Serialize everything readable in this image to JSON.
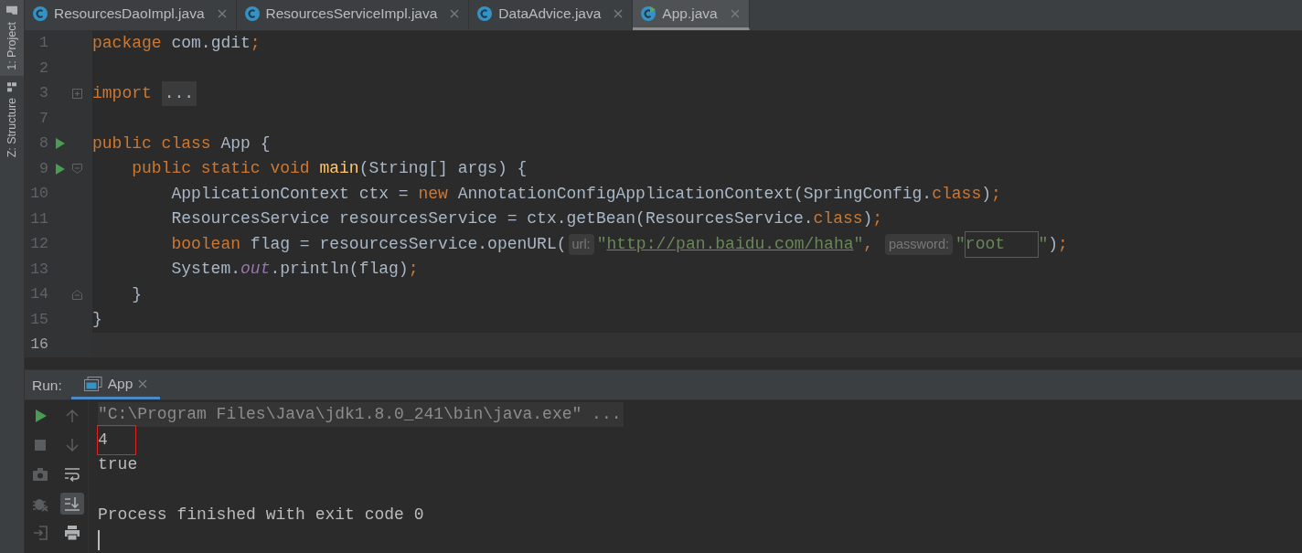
{
  "sidebar": {
    "items": [
      {
        "label": "1: Project",
        "kind": "folder"
      },
      {
        "label": "Z: Structure",
        "kind": "structure"
      }
    ]
  },
  "tabs": [
    {
      "label": "ResourcesDaoImpl.java",
      "kind": "class",
      "selected": false
    },
    {
      "label": "ResourcesServiceImpl.java",
      "kind": "class",
      "selected": false
    },
    {
      "label": "DataAdvice.java",
      "kind": "class",
      "selected": false
    },
    {
      "label": "App.java",
      "kind": "runnable-class",
      "selected": true
    }
  ],
  "editor": {
    "lines": [
      {
        "number": "1",
        "kind": "code",
        "current": false,
        "run": false,
        "tokens": [
          {
            "kind": "kw",
            "text": "package"
          },
          {
            "kind": "plain",
            "text": " com.gdit"
          },
          {
            "kind": "kw",
            "text": ";"
          }
        ]
      },
      {
        "number": "2",
        "kind": "code",
        "current": false,
        "run": false
      },
      {
        "number": "3",
        "kind": "collapsed",
        "current": false,
        "run": false,
        "tokens": [
          {
            "kind": "kw",
            "text": "import "
          },
          {
            "kind": "folded",
            "text": "..."
          }
        ]
      },
      {
        "number": "7",
        "kind": "code",
        "current": false,
        "run": false
      },
      {
        "number": "8",
        "kind": "code",
        "current": false,
        "run": true,
        "tokens": [
          {
            "kind": "kw",
            "text": "public class"
          },
          {
            "kind": "plain",
            "text": " App {"
          }
        ]
      },
      {
        "number": "9",
        "kind": "fold-start",
        "current": false,
        "run": true,
        "tokens": [
          {
            "kind": "kw",
            "text": "    public static void "
          },
          {
            "kind": "method",
            "text": "main"
          },
          {
            "kind": "plain",
            "text": "(String[] args) {"
          }
        ]
      },
      {
        "number": "10",
        "kind": "code",
        "current": false,
        "run": false,
        "tokens": [
          {
            "kind": "plain",
            "text": "        ApplicationContext ctx = "
          },
          {
            "kind": "kw",
            "text": "new"
          },
          {
            "kind": "plain",
            "text": " AnnotationConfigApplicationContext(SpringConfig."
          },
          {
            "kind": "kw",
            "text": "class"
          },
          {
            "kind": "plain",
            "text": ")"
          },
          {
            "kind": "kw",
            "text": ";"
          }
        ]
      },
      {
        "number": "11",
        "kind": "code",
        "current": false,
        "run": false,
        "tokens": [
          {
            "kind": "plain",
            "text": "        ResourcesService resourcesService = ctx.getBean(ResourcesService."
          },
          {
            "kind": "kw",
            "text": "class"
          },
          {
            "kind": "plain",
            "text": ")"
          },
          {
            "kind": "kw",
            "text": ";"
          }
        ]
      },
      {
        "number": "12",
        "kind": "code",
        "current": false,
        "run": false,
        "tokens": [
          {
            "kind": "kw",
            "text": "        boolean"
          },
          {
            "kind": "plain",
            "text": " flag = resourcesService.openURL("
          },
          {
            "kind": "hint",
            "text": "url:"
          },
          {
            "kind": "str",
            "text": "\""
          },
          {
            "kind": "link",
            "text": "http://pan.baidu.com/haha"
          },
          {
            "kind": "str",
            "text": "\""
          },
          {
            "kind": "kw",
            "text": ", "
          },
          {
            "kind": "hint",
            "text": "password:"
          },
          {
            "kind": "str",
            "text": "\""
          },
          {
            "kind": "str",
            "text": "root   ",
            "highlighted": true
          },
          {
            "kind": "str",
            "text": "\""
          },
          {
            "kind": "plain",
            "text": ")"
          },
          {
            "kind": "kw",
            "text": ";"
          }
        ]
      },
      {
        "number": "13",
        "kind": "code",
        "current": false,
        "run": false,
        "tokens": [
          {
            "kind": "plain",
            "text": "        System."
          },
          {
            "kind": "field",
            "text": "out"
          },
          {
            "kind": "plain",
            "text": ".println(flag)"
          },
          {
            "kind": "kw",
            "text": ";"
          }
        ]
      },
      {
        "number": "14",
        "kind": "fold-end",
        "current": false,
        "run": false,
        "tokens": [
          {
            "kind": "plain",
            "text": "    }"
          }
        ]
      },
      {
        "number": "15",
        "kind": "code",
        "current": false,
        "run": false,
        "tokens": [
          {
            "kind": "plain",
            "text": "}"
          }
        ]
      },
      {
        "number": "16",
        "kind": "code",
        "current": true,
        "run": false
      }
    ]
  },
  "run_panel": {
    "title": "Run:",
    "tabs": [
      {
        "label": "App",
        "selected": true
      }
    ],
    "toolbar_left": [
      {
        "kind": "run",
        "disabled": false
      },
      {
        "kind": "stop",
        "disabled": true
      },
      {
        "kind": "camera",
        "disabled": true
      },
      {
        "kind": "debug",
        "disabled": true
      },
      {
        "kind": "exit",
        "disabled": true
      }
    ],
    "toolbar_right": [
      {
        "kind": "up",
        "disabled": true,
        "on": false
      },
      {
        "kind": "down",
        "disabled": true,
        "on": false
      },
      {
        "kind": "wrap",
        "disabled": false,
        "on": false
      },
      {
        "kind": "scroll-end",
        "disabled": false,
        "on": true
      },
      {
        "kind": "print",
        "disabled": false,
        "on": false
      }
    ],
    "console": [
      {
        "kind": "command",
        "text": "\"C:\\Program Files\\Java\\jdk1.8.0_241\\bin\\java.exe\" ..."
      },
      {
        "kind": "output",
        "text": "4",
        "highlighted": true
      },
      {
        "kind": "output",
        "text": "true",
        "highlighted": false
      },
      {
        "kind": "blank"
      },
      {
        "kind": "output",
        "text": "Process finished with exit code 0",
        "highlighted": false
      },
      {
        "kind": "caret"
      }
    ]
  }
}
